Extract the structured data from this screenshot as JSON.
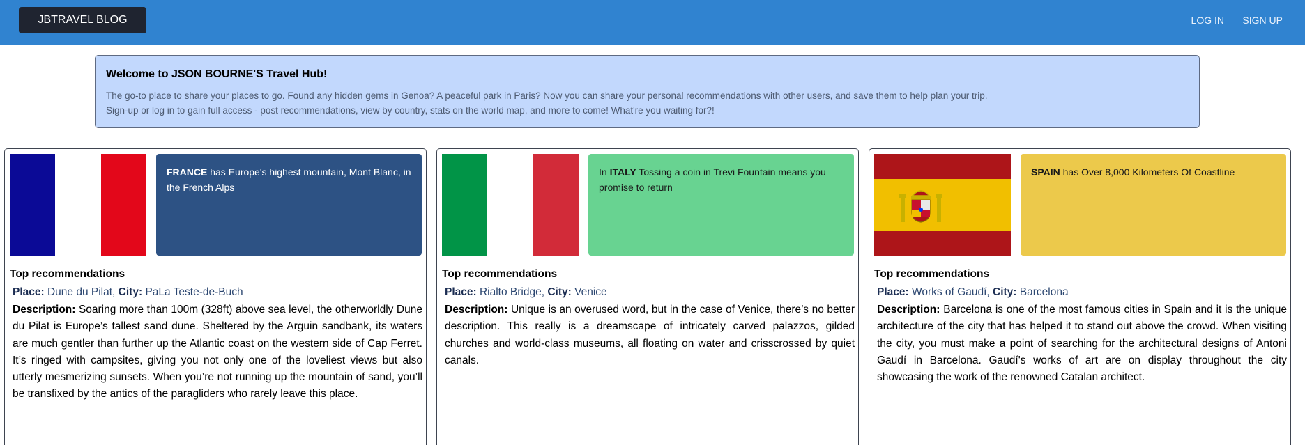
{
  "navbar": {
    "brand": "JBTRAVEL BLOG",
    "login": "LOG IN",
    "signup": "SIGN UP"
  },
  "welcome": {
    "title": "Welcome to JSON BOURNE'S Travel Hub!",
    "line1": "The go-to place to share your places to go. Found any hidden gems in Genoa? A peaceful park in Paris? Now you can share your personal recommendations with other users, and save them to help plan your trip.",
    "line2": "Sign-up or log in to gain full access - post recommendations, view by country, stats on the world map, and more to come! What're you waiting for?!"
  },
  "labels": {
    "top_recommendations": "Top recommendations",
    "place": "Place:",
    "city": "City:",
    "description": "Description:"
  },
  "cards": [
    {
      "country": "FRANCE",
      "fact_prefix": "",
      "fact_text": " has Europe's highest mountain, Mont Blanc, in the French Alps",
      "fact_color": "#2d5284",
      "fact_text_color": "#ffffff",
      "flag_icon": "france-flag-icon",
      "place": "Dune du Pilat",
      "city": "PaLa Teste-de-Buch",
      "description": "Soaring more than 100m (328ft) above sea level, the otherworldly Dune du Pilat is Europe’s tallest sand dune. Sheltered by the Arguin sandbank, its waters are much gentler than further up the Atlantic coast on the western side of Cap Ferret. It’s ringed with campsites, giving you not only one of the loveliest views but also utterly mesmerizing sunsets. When you’re not running up the mountain of sand, you’ll be transfixed by the antics of the paragliders who rarely leave this place."
    },
    {
      "country": "ITALY",
      "fact_prefix": "In ",
      "fact_text": " Tossing a coin in Trevi Fountain means you promise to return",
      "fact_color": "#68d391",
      "fact_text_color": "#1a1a1a",
      "flag_icon": "italy-flag-icon",
      "place": "Rialto Bridge",
      "city": "Venice",
      "description": "Unique is an overused word, but in the case of Venice, there’s no better description. This really is a dreamscape of intricately carved palazzos, gilded churches and world-class museums, all floating on water and crisscrossed by quiet canals."
    },
    {
      "country": "SPAIN",
      "fact_prefix": "",
      "fact_text": " has Over 8,000 Kilometers Of Coastline",
      "fact_color": "#ecc94b",
      "fact_text_color": "#1a1a1a",
      "flag_icon": "spain-flag-icon",
      "place": "Works of Gaudí",
      "city": "Barcelona",
      "description": "Barcelona is one of the most famous cities in Spain and it is the unique architecture of the city that has helped it to stand out above the crowd. When visiting the city, you must make a point of searching for the architectural designs of Antoni Gaudí in Barcelona. Gaudí's works of art are on display throughout the city showcasing the work of the renowned Catalan architect."
    }
  ]
}
